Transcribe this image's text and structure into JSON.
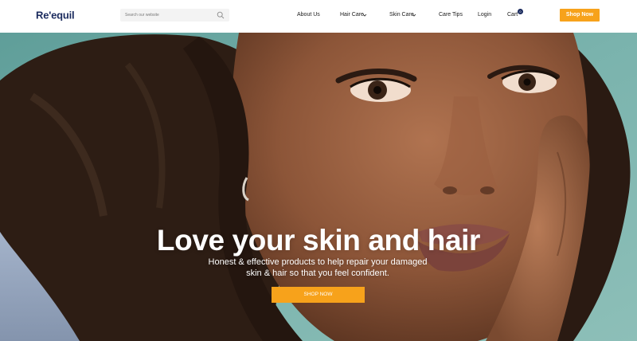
{
  "brand": {
    "logo_text": "Re'equil",
    "accent_color": "#f7a21b",
    "brand_color": "#1b2b5e"
  },
  "search": {
    "placeholder": "Search our website",
    "icon": "search-icon"
  },
  "nav": {
    "about": "About Us",
    "hair_care": "Hair Care",
    "skin_care": "Skin Care",
    "care_tips": "Care Tips",
    "login": "Login",
    "cart": "Cart",
    "cart_count": "0"
  },
  "header_cta": "Shop Now",
  "hero": {
    "title": "Love your skin and hair",
    "subtitle": "Honest & effective products to help repair your damaged skin & hair so that you feel confident.",
    "cta": "SHOP NOW"
  }
}
